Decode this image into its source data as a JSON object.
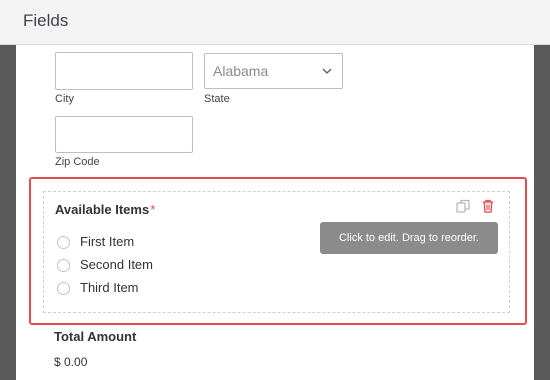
{
  "header": {
    "title": "Fields"
  },
  "address": {
    "city_label": "City",
    "state_label": "State",
    "state_value": "Alabama",
    "zip_label": "Zip Code"
  },
  "available_items": {
    "label": "Available Items",
    "required_mark": "*",
    "options": [
      "First Item",
      "Second Item",
      "Third Item"
    ],
    "tooltip": "Click to edit. Drag to reorder.",
    "icons": [
      "duplicate-icon",
      "trash-icon"
    ]
  },
  "total": {
    "label": "Total Amount",
    "value": "$ 0.00"
  },
  "colors": {
    "highlight": "#e24b4f",
    "sidebar": "#595959",
    "tooltip_bg": "#8b8b8b"
  }
}
